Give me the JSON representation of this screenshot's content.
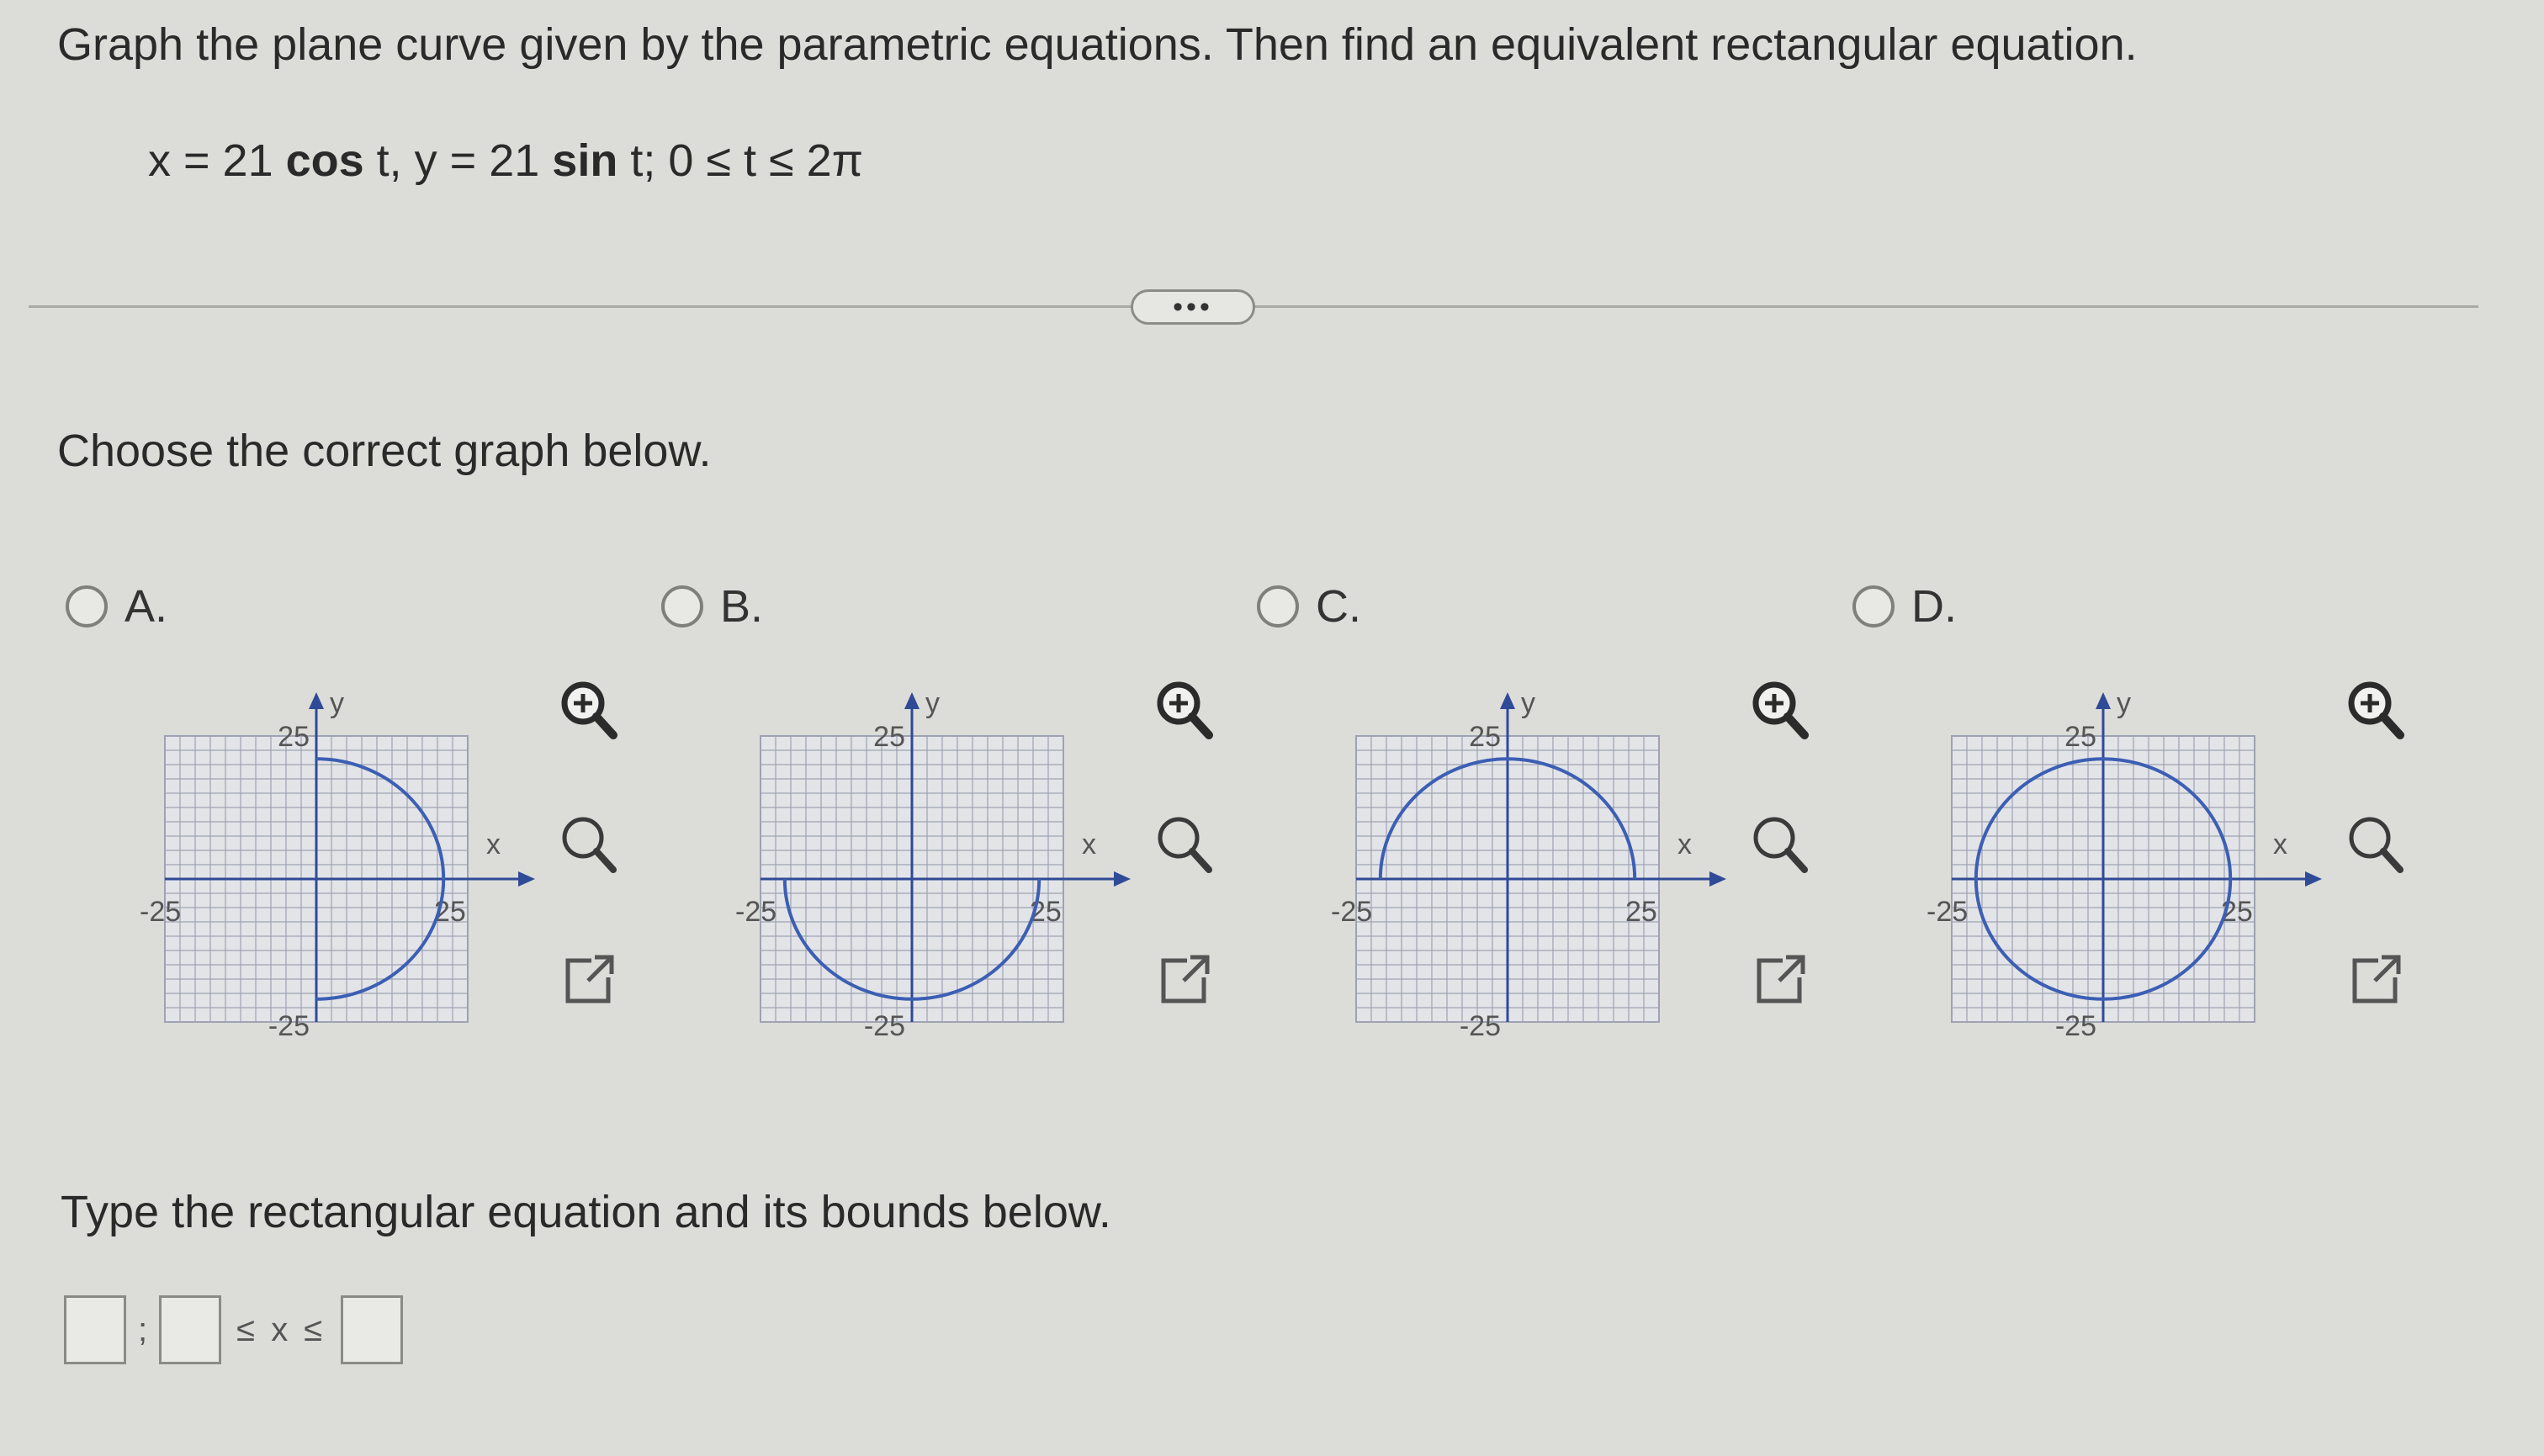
{
  "question": "Graph the plane curve given by the parametric equations. Then find an equivalent rectangular equation.",
  "equation": {
    "x_eq": "x = 21 ",
    "x_func": "cos",
    "x_var": " t, y = 21 ",
    "y_func": "sin",
    "rest": " t; 0 ≤ t ≤ 2π"
  },
  "more_button": "•••",
  "prompt": "Choose the correct graph below.",
  "options": [
    {
      "label": "A.",
      "arc": "right-half"
    },
    {
      "label": "B.",
      "arc": "lower-half"
    },
    {
      "label": "C.",
      "arc": "upper-half"
    },
    {
      "label": "D.",
      "arc": "full-circle"
    }
  ],
  "graph_labels": {
    "y_axis": "y",
    "x_axis": "x",
    "tick_pos": "25",
    "tick_neg": "-25"
  },
  "graph_range": [
    -25,
    25
  ],
  "curve_radius": 21,
  "tools": {
    "zoom_in": "zoom-in-icon",
    "zoom_out": "zoom-out-icon",
    "popout": "open-in-new-window-icon"
  },
  "colors": {
    "curve": "#3c5fb4",
    "grid": "#9ea3b2",
    "axis": "#2f4a96"
  },
  "prompt2": "Type the rectangular equation and its bounds below.",
  "answer": {
    "separator": ";",
    "inequality": "≤ x ≤"
  }
}
